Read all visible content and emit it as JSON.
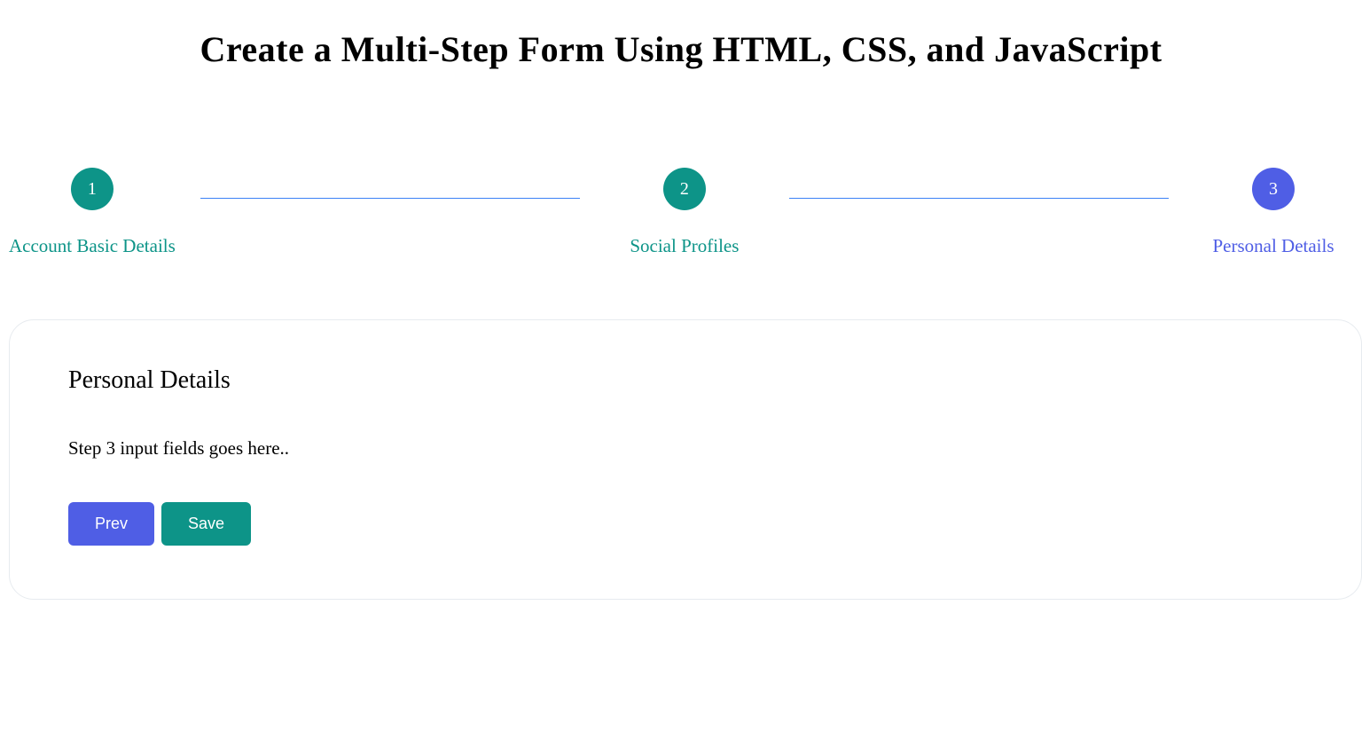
{
  "page_title": "Create a Multi-Step Form Using HTML, CSS, and JavaScript",
  "stepper": {
    "steps": [
      {
        "number": "1",
        "label": "Account Basic Details",
        "state": "done"
      },
      {
        "number": "2",
        "label": "Social Profiles",
        "state": "done"
      },
      {
        "number": "3",
        "label": "Personal Details",
        "state": "active"
      }
    ]
  },
  "form": {
    "title": "Personal Details",
    "body": "Step 3 input fields goes here..",
    "buttons": {
      "prev_label": "Prev",
      "save_label": "Save"
    }
  }
}
